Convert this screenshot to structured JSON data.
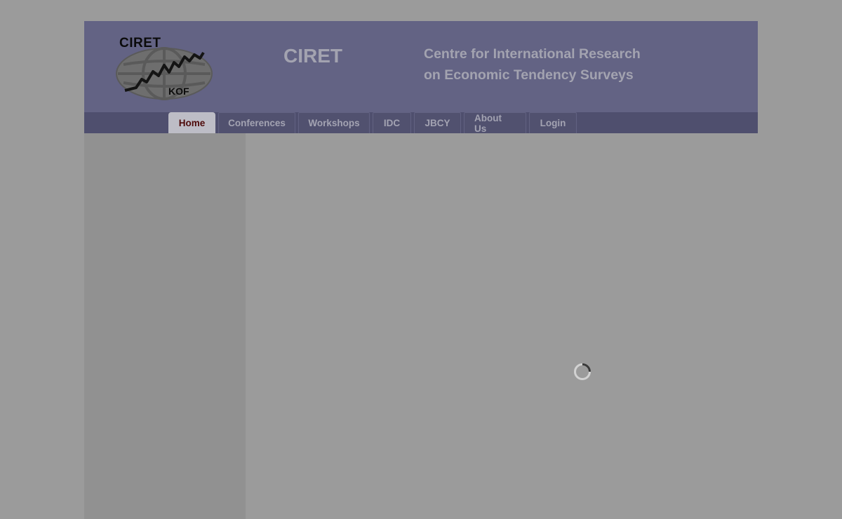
{
  "header": {
    "logo_text": "CIRET",
    "logo_sub": "KOF",
    "site_name": "CIRET",
    "tagline_line1": "Centre for International Research",
    "tagline_line2": "on Economic Tendency Surveys"
  },
  "nav": {
    "tabs": [
      {
        "label": "Home",
        "active": true
      },
      {
        "label": "Conferences"
      },
      {
        "label": "Workshops"
      },
      {
        "label": "IDC"
      },
      {
        "label": "JBCY"
      },
      {
        "label": "About Us"
      },
      {
        "label": "Login"
      }
    ]
  },
  "colors": {
    "header_bg": "#636384",
    "nav_bg": "#4f4f6e",
    "page_bg": "#9b9b9b",
    "sidebar_bg": "#919191",
    "active_tab_text": "#4e0a0a"
  },
  "icons": {
    "logo": "globe-chart-logo",
    "loading": "loading-spinner-icon"
  }
}
